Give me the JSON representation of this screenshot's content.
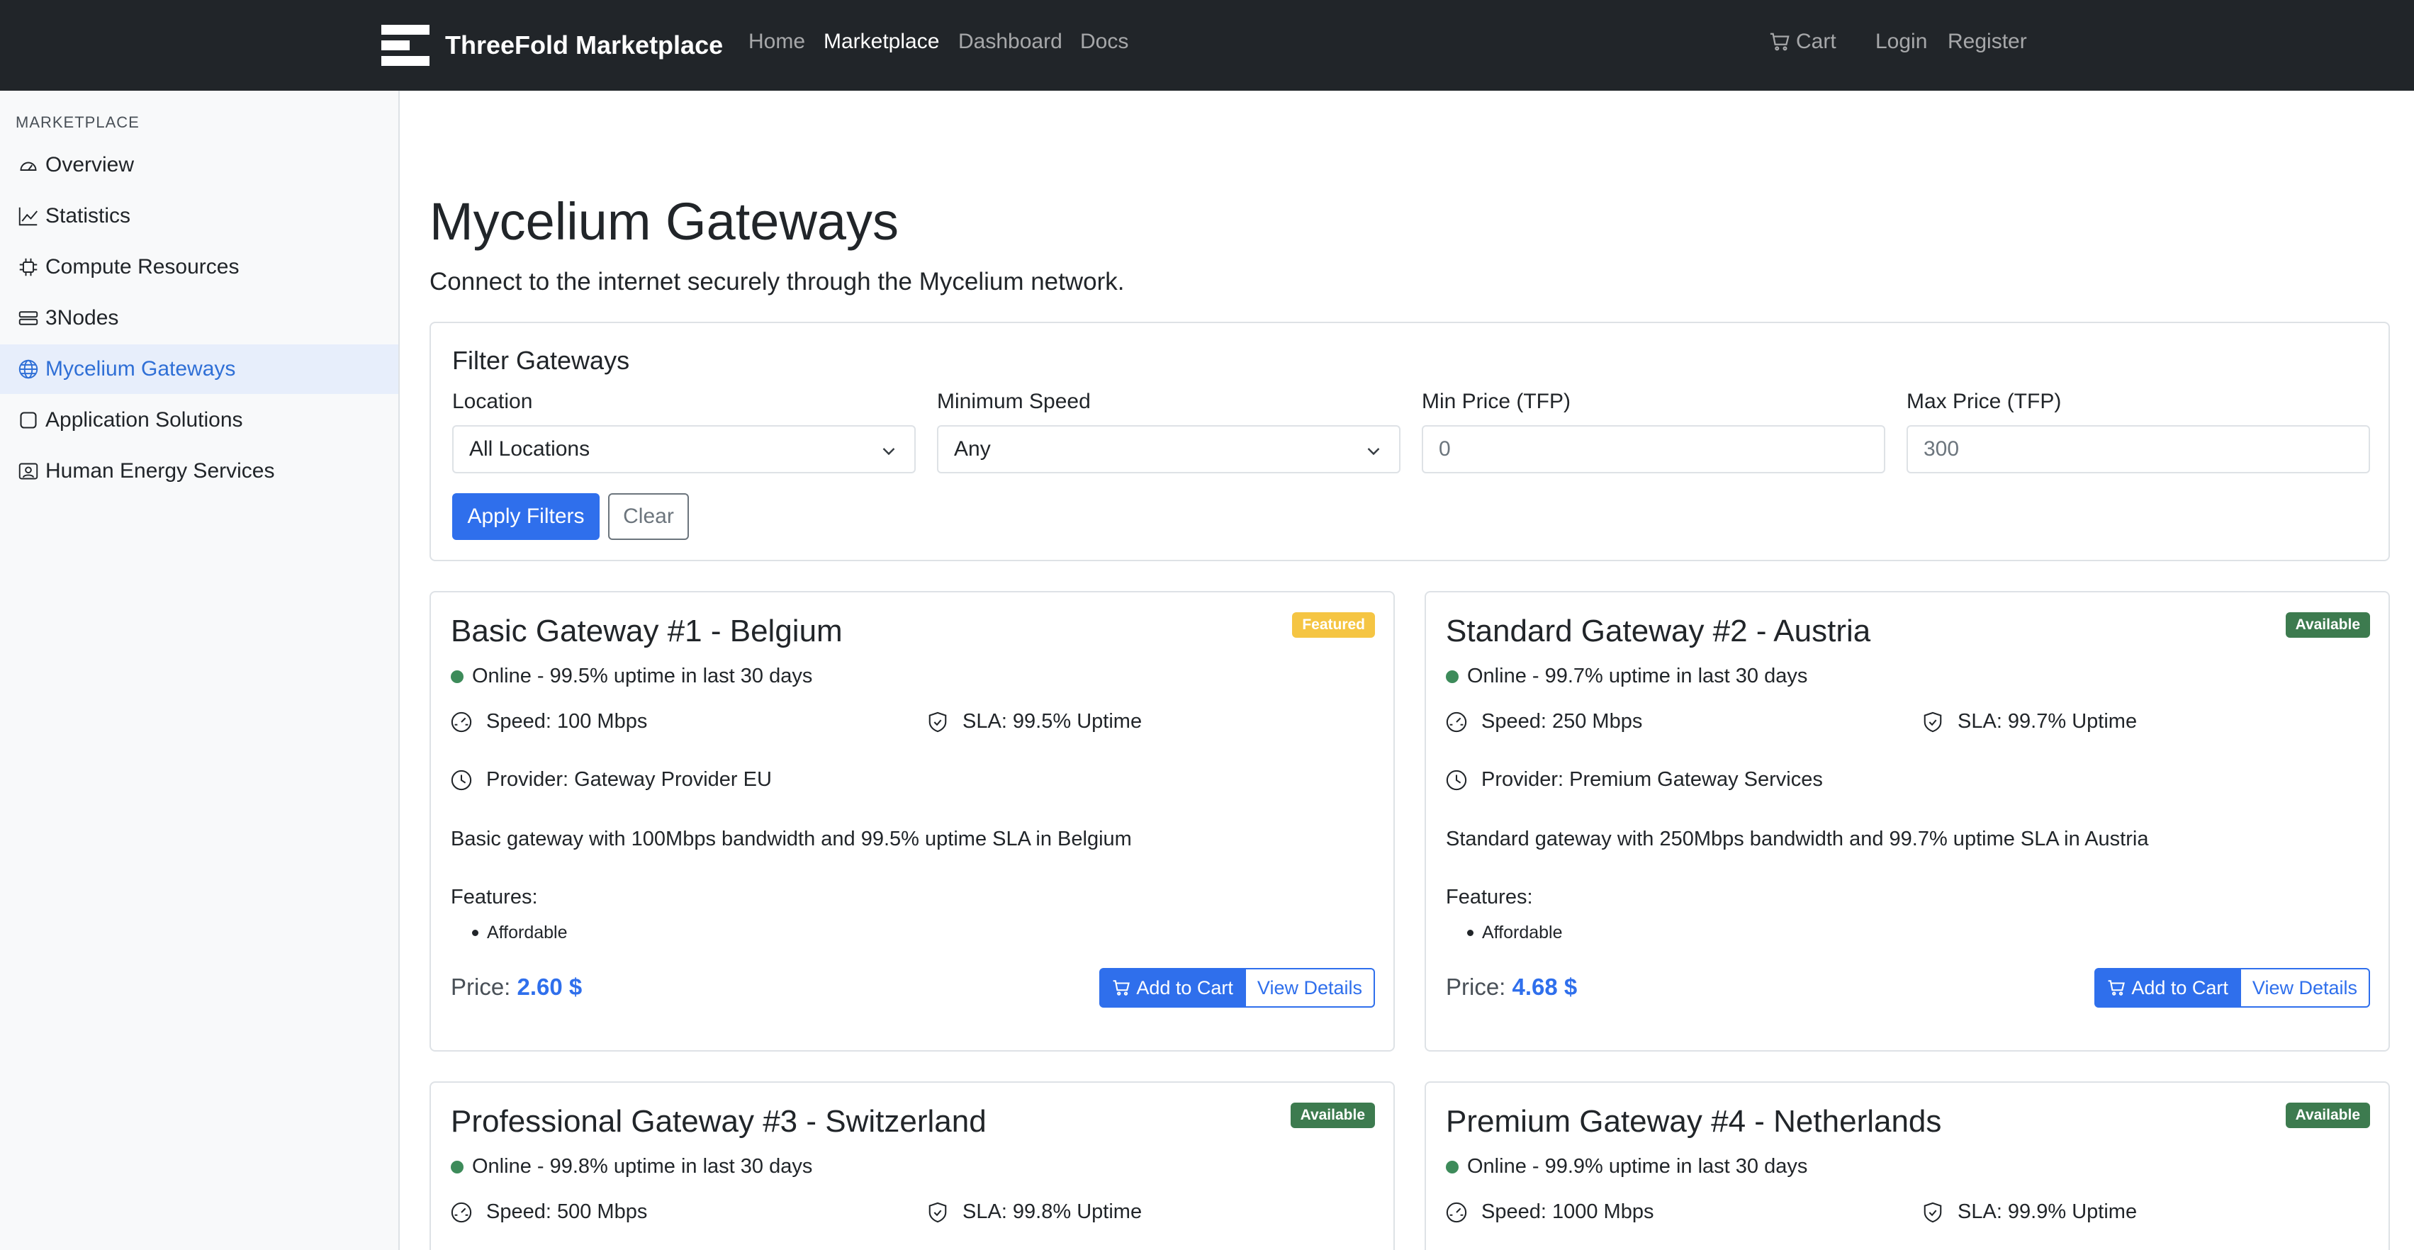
{
  "navbar": {
    "brand": "ThreeFold Marketplace",
    "links": [
      {
        "label": "Home"
      },
      {
        "label": "Marketplace"
      },
      {
        "label": "Dashboard"
      },
      {
        "label": "Docs"
      }
    ],
    "cart_label": "Cart",
    "login_label": "Login",
    "register_label": "Register"
  },
  "sidebar": {
    "heading": "MARKETPLACE",
    "items": [
      {
        "label": "Overview",
        "icon": "speedometer-icon"
      },
      {
        "label": "Statistics",
        "icon": "graph-icon"
      },
      {
        "label": "Compute Resources",
        "icon": "cpu-icon"
      },
      {
        "label": "3Nodes",
        "icon": "server-icon"
      },
      {
        "label": "Mycelium Gateways",
        "icon": "globe-icon"
      },
      {
        "label": "Application Solutions",
        "icon": "app-icon"
      },
      {
        "label": "Human Energy Services",
        "icon": "person-badge-icon"
      }
    ],
    "active_item": "Mycelium Gateways"
  },
  "page": {
    "title": "Mycelium Gateways",
    "subtitle": "Connect to the internet securely through the Mycelium network."
  },
  "filters": {
    "title": "Filter Gateways",
    "location": {
      "label": "Location",
      "value": "All Locations"
    },
    "min_speed": {
      "label": "Minimum Speed",
      "value": "Any"
    },
    "min_price": {
      "label": "Min Price (TFP)",
      "placeholder": "0"
    },
    "max_price": {
      "label": "Max Price (TFP)",
      "placeholder": "300"
    },
    "apply_label": "Apply Filters",
    "clear_label": "Clear"
  },
  "gateways": [
    {
      "title": "Basic Gateway #1 - Belgium",
      "badge": "Featured",
      "status": "Online - 99.5% uptime in last 30 days",
      "speed": "Speed: 100 Mbps",
      "sla": "SLA: 99.5% Uptime",
      "provider": "Provider: Gateway Provider EU",
      "description": "Basic gateway with 100Mbps bandwidth and 99.5% uptime SLA in Belgium",
      "features_label": "Features:",
      "features": [
        "Affordable"
      ],
      "price_label": "Price:",
      "price": "2.60 $",
      "add_to_cart_label": "Add to Cart",
      "view_details_label": "View Details"
    },
    {
      "title": "Standard Gateway #2 - Austria",
      "badge": "Available",
      "status": "Online - 99.7% uptime in last 30 days",
      "speed": "Speed: 250 Mbps",
      "sla": "SLA: 99.7% Uptime",
      "provider": "Provider: Premium Gateway Services",
      "description": "Standard gateway with 250Mbps bandwidth and 99.7% uptime SLA in Austria",
      "features_label": "Features:",
      "features": [
        "Affordable"
      ],
      "price_label": "Price:",
      "price": "4.68 $",
      "add_to_cart_label": "Add to Cart",
      "view_details_label": "View Details"
    },
    {
      "title": "Professional Gateway #3 - Switzerland",
      "badge": "Available",
      "status": "Online - 99.8% uptime in last 30 days",
      "speed": "Speed: 500 Mbps",
      "sla": "SLA: 99.8% Uptime"
    },
    {
      "title": "Premium Gateway #4 - Netherlands",
      "badge": "Available",
      "status": "Online - 99.9% uptime in last 30 days",
      "speed": "Speed: 1000 Mbps",
      "sla": "SLA: 99.9% Uptime"
    }
  ],
  "colors": {
    "navbar_bg": "#212529",
    "primary": "#2f6fec",
    "featured_badge": "#f5c543",
    "available_badge": "#3d7b4f",
    "online_dot": "#3d8b5a",
    "sidebar_active_bg": "#e7eefb"
  }
}
